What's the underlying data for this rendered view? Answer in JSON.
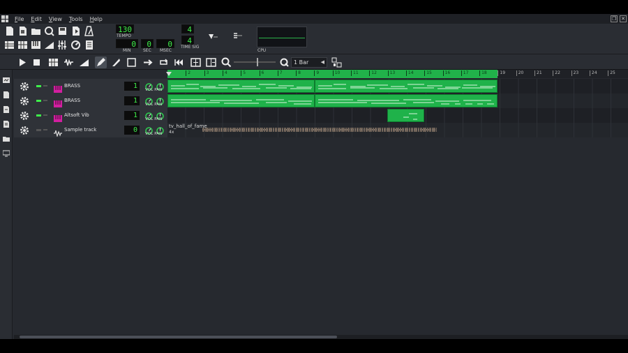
{
  "menu": [
    "File",
    "Edit",
    "View",
    "Tools",
    "Help"
  ],
  "transport": {
    "tempo": "130",
    "tempo_label": "TEMPO",
    "min": "0",
    "sec": "0",
    "msec": "0",
    "min_label": "MIN",
    "sec_label": "SEC",
    "msec_label": "MSEC",
    "timesig_num": "4",
    "timesig_den": "4",
    "timesig_label": "TIME SIG",
    "cpu_label": "CPU"
  },
  "quantize": {
    "value": "1 Bar"
  },
  "timeline": {
    "bars": [
      "1",
      "2",
      "3",
      "4",
      "5",
      "6",
      "7",
      "8",
      "9",
      "10",
      "11",
      "12",
      "13",
      "14",
      "15",
      "16",
      "17",
      "18",
      "19",
      "20",
      "21",
      "22",
      "23",
      "24",
      "25"
    ],
    "loop_end_bar": 19
  },
  "tracks": [
    {
      "name": "BRASS",
      "type": "instrument",
      "lcd": "1",
      "volpan": "VOL PAN"
    },
    {
      "name": "BRASS",
      "type": "instrument",
      "lcd": "1",
      "volpan": "VOL PAN"
    },
    {
      "name": "Altsoft Vib",
      "type": "instrument",
      "lcd": "1",
      "volpan": "VOL PAN"
    },
    {
      "name": "Sample track",
      "type": "sample",
      "lcd": "0",
      "volpan": "VOL PAN",
      "clip_name": "tv_hall_of_fame",
      "clip_repeat": "4x"
    }
  ],
  "colors": {
    "accent": "#1fb24a",
    "lcd_text": "#3ef04a",
    "background": "#26292f"
  }
}
